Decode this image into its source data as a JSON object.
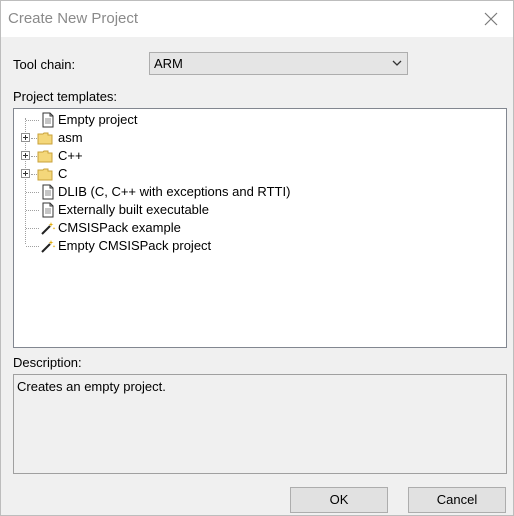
{
  "window": {
    "title": "Create New Project"
  },
  "toolchain": {
    "label": "Tool chain:",
    "selected": "ARM"
  },
  "templates": {
    "label": "Project templates:",
    "items": [
      {
        "label": "Empty project",
        "icon": "document-icon",
        "expandable": false
      },
      {
        "label": "asm",
        "icon": "folder-icon",
        "expandable": true
      },
      {
        "label": "C++",
        "icon": "folder-icon",
        "expandable": true
      },
      {
        "label": "C",
        "icon": "folder-icon",
        "expandable": true
      },
      {
        "label": "DLIB (C, C++ with exceptions and RTTI)",
        "icon": "document-icon",
        "expandable": false
      },
      {
        "label": "Externally built executable",
        "icon": "document-icon",
        "expandable": false
      },
      {
        "label": "CMSISPack example",
        "icon": "wand-icon",
        "expandable": false
      },
      {
        "label": "Empty CMSISPack project",
        "icon": "wand-icon",
        "expandable": false
      }
    ]
  },
  "description": {
    "label": "Description:",
    "text": "Creates an empty project."
  },
  "buttons": {
    "ok": "OK",
    "cancel": "Cancel"
  },
  "colors": {
    "dialog_bg": "#f0f0f0",
    "title_text": "#8a8a8a",
    "folder": "#f4d77a"
  }
}
